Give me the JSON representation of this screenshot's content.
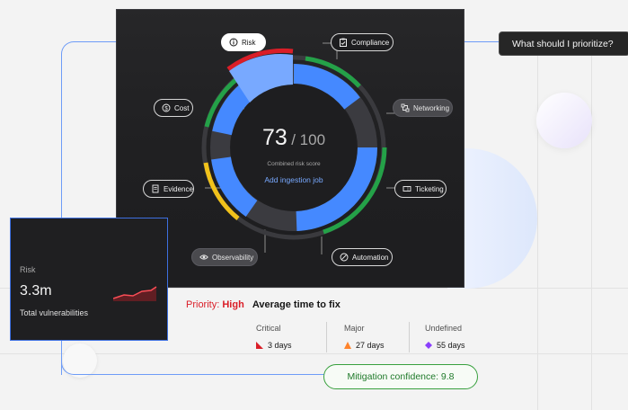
{
  "score": {
    "value": "73",
    "total": "/ 100",
    "label": "Combined risk score",
    "action": "Add ingestion job"
  },
  "nodes": {
    "risk": {
      "label": "Risk",
      "icon": "info-icon"
    },
    "compliance": {
      "label": "Compliance",
      "icon": "clipboard-icon"
    },
    "networking": {
      "label": "Networking",
      "icon": "network-icon"
    },
    "ticketing": {
      "label": "Ticketing",
      "icon": "ticket-icon"
    },
    "automation": {
      "label": "Automation",
      "icon": "automation-icon"
    },
    "observability": {
      "label": "Observability",
      "icon": "eye-icon"
    },
    "evidence": {
      "label": "Evidence",
      "icon": "document-icon"
    },
    "cost": {
      "label": "Cost",
      "icon": "dollar-icon"
    }
  },
  "tooltip": {
    "text": "What should I prioritize?"
  },
  "risk_card": {
    "title": "Risk",
    "value": "3.3m",
    "caption": "Total vulnerabilities"
  },
  "priority": {
    "label": "Priority:",
    "level": "High",
    "heading": "Average time to fix"
  },
  "fix_times": [
    {
      "name": "Critical",
      "value": "3 days",
      "color": "#da1e28",
      "icon": "triangle-icon"
    },
    {
      "name": "Major",
      "value": "27 days",
      "color": "#ff832b",
      "icon": "triangle-icon"
    },
    {
      "name": "Undefined",
      "value": "55 days",
      "color": "#8a3ffc",
      "icon": "diamond-icon"
    }
  ],
  "confidence": {
    "text": "Mitigation confidence: 9.8"
  },
  "colors": {
    "accent_blue": "#4589ff",
    "green": "#24a148",
    "red": "#da1e28",
    "yellow": "#f1c21b",
    "dark": "#1e1e20"
  }
}
